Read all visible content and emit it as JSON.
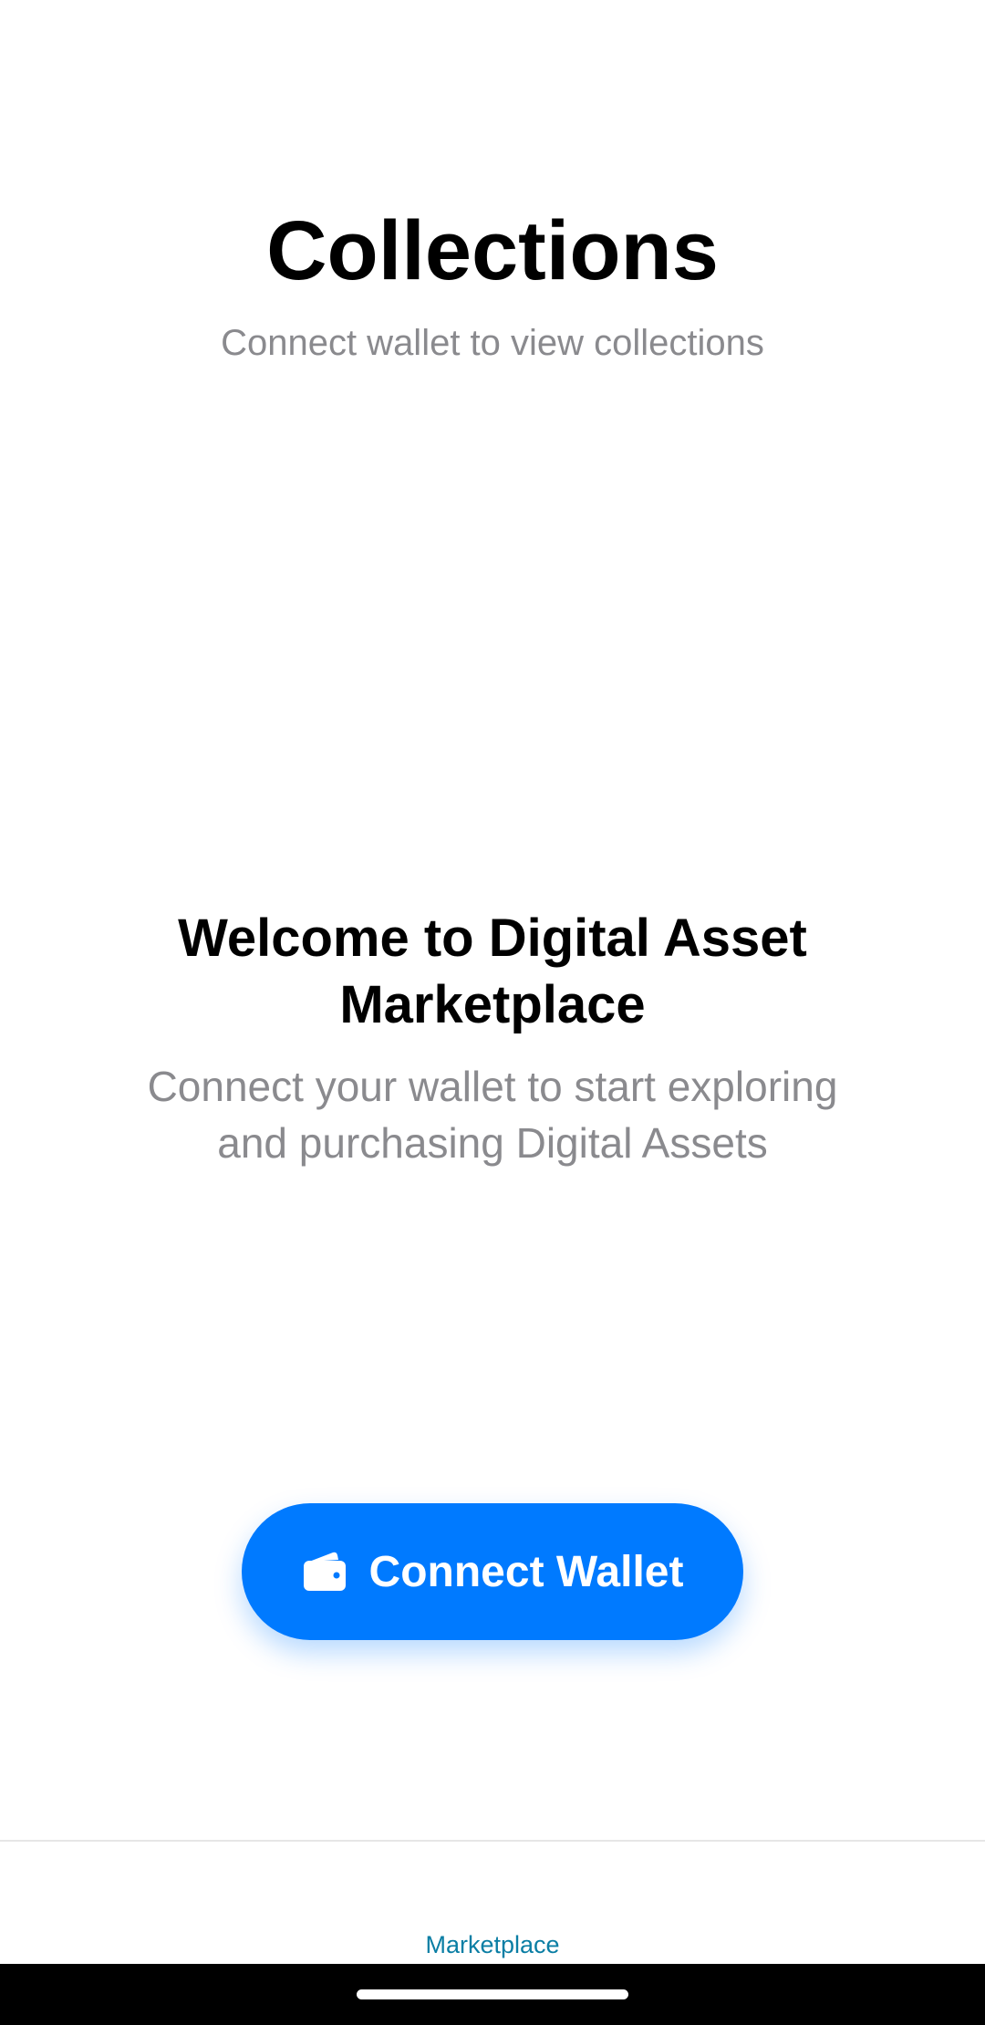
{
  "header": {
    "title": "Collections",
    "subtitle": "Connect wallet to view collections"
  },
  "welcome": {
    "title": "Welcome to Digital Asset Marketplace",
    "description": "Connect your wallet to start exploring and purchasing Digital Assets"
  },
  "connect_button": {
    "label": "Connect Wallet",
    "icon": "wallet-icon",
    "color": "#007aff"
  },
  "tab_bar": {
    "items": [
      {
        "label": "Marketplace",
        "active": true,
        "color": "#0a7ea4"
      }
    ]
  },
  "colors": {
    "background": "#ffffff",
    "title": "#000000",
    "secondary_text": "#8a8a8e",
    "accent": "#007aff"
  }
}
